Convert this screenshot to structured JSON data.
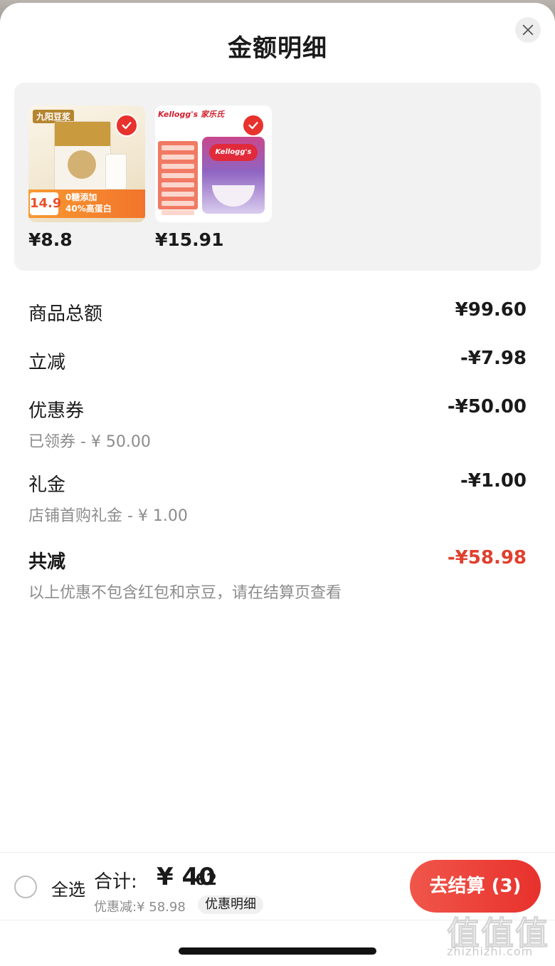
{
  "sheet": {
    "title": "金额明细",
    "close_icon": "close-icon"
  },
  "products": [
    {
      "price": "¥8.8",
      "selected": true,
      "image": {
        "brand": "九阳豆浆",
        "badge_price": "14.9",
        "tag_line1": "0糖添加",
        "tag_line2": "40%高蛋白"
      }
    },
    {
      "price": "¥15.91",
      "selected": true,
      "image": {
        "brand": "Kellogg's 家乐氏",
        "logo": "Kellogg's"
      }
    }
  ],
  "breakdown": {
    "goods_total": {
      "label": "商品总额",
      "value": "¥99.60"
    },
    "instant_discount": {
      "label": "立减",
      "value": "-¥7.98"
    },
    "coupon": {
      "label": "优惠券",
      "value": "-¥50.00",
      "sub": "已领券 - ¥ 50.00"
    },
    "gift_money": {
      "label": "礼金",
      "value": "-¥1.00",
      "sub": "店铺首购礼金 - ¥ 1.00"
    },
    "total_saved": {
      "label": "共减",
      "value": "-¥58.98",
      "sub": "以上优惠不包含红包和京豆，请在结算页查看"
    }
  },
  "footer": {
    "select_all_label": "全选",
    "total_label": "合计:",
    "total_integer": "¥ 40",
    "total_decimal": ".62",
    "discount_text": "优惠减:¥ 58.98",
    "detail_label": "优惠明细",
    "checkout_label": "去结算 (3)"
  },
  "watermark": {
    "chars": [
      "值",
      "值",
      "值"
    ],
    "url": "zhizhizhi.com"
  },
  "colors": {
    "accent_red": "#e8322d",
    "discount_red": "#e0402e",
    "muted_text": "#8c8c8c"
  }
}
